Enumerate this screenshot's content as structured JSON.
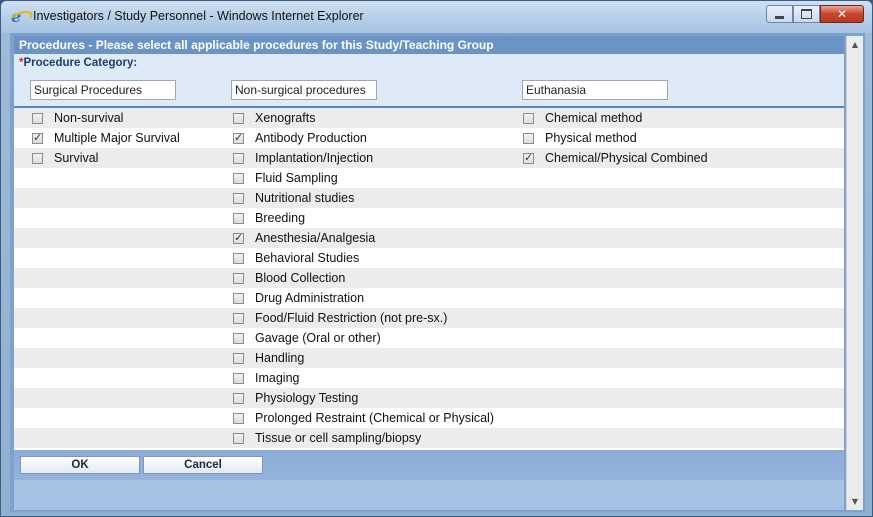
{
  "window": {
    "title": "Investigators / Study Personnel - Windows Internet Explorer",
    "icon": "internet-explorer-icon"
  },
  "dialog": {
    "header": "Procedures - Please select all applicable procedures for this Study/Teaching Group",
    "required_marker": "*",
    "category_label": "Procedure Category:",
    "categories": [
      "Surgical Procedures",
      "Non-surgical procedures",
      "Euthanasia"
    ]
  },
  "columns": {
    "surgical": [
      {
        "label": "Non-survival",
        "checked": false
      },
      {
        "label": "Multiple Major Survival",
        "checked": true
      },
      {
        "label": "Survival",
        "checked": false
      }
    ],
    "non_surgical": [
      {
        "label": "Xenografts",
        "checked": false
      },
      {
        "label": "Antibody Production",
        "checked": true
      },
      {
        "label": "Implantation/Injection",
        "checked": false
      },
      {
        "label": "Fluid Sampling",
        "checked": false
      },
      {
        "label": "Nutritional studies",
        "checked": false
      },
      {
        "label": "Breeding",
        "checked": false
      },
      {
        "label": "Anesthesia/Analgesia",
        "checked": true
      },
      {
        "label": "Behavioral Studies",
        "checked": false
      },
      {
        "label": "Blood Collection",
        "checked": false
      },
      {
        "label": "Drug Administration",
        "checked": false
      },
      {
        "label": "Food/Fluid Restriction (not pre-sx.)",
        "checked": false
      },
      {
        "label": "Gavage (Oral or other)",
        "checked": false
      },
      {
        "label": "Handling",
        "checked": false
      },
      {
        "label": "Imaging",
        "checked": false
      },
      {
        "label": "Physiology Testing",
        "checked": false
      },
      {
        "label": "Prolonged Restraint (Chemical or Physical)",
        "checked": false
      },
      {
        "label": "Tissue or cell sampling/biopsy",
        "checked": false
      }
    ],
    "euthanasia": [
      {
        "label": "Chemical method",
        "checked": false
      },
      {
        "label": "Physical method",
        "checked": false
      },
      {
        "label": "Chemical/Physical Combined",
        "checked": true
      }
    ]
  },
  "buttons": {
    "ok": "OK",
    "cancel": "Cancel"
  }
}
